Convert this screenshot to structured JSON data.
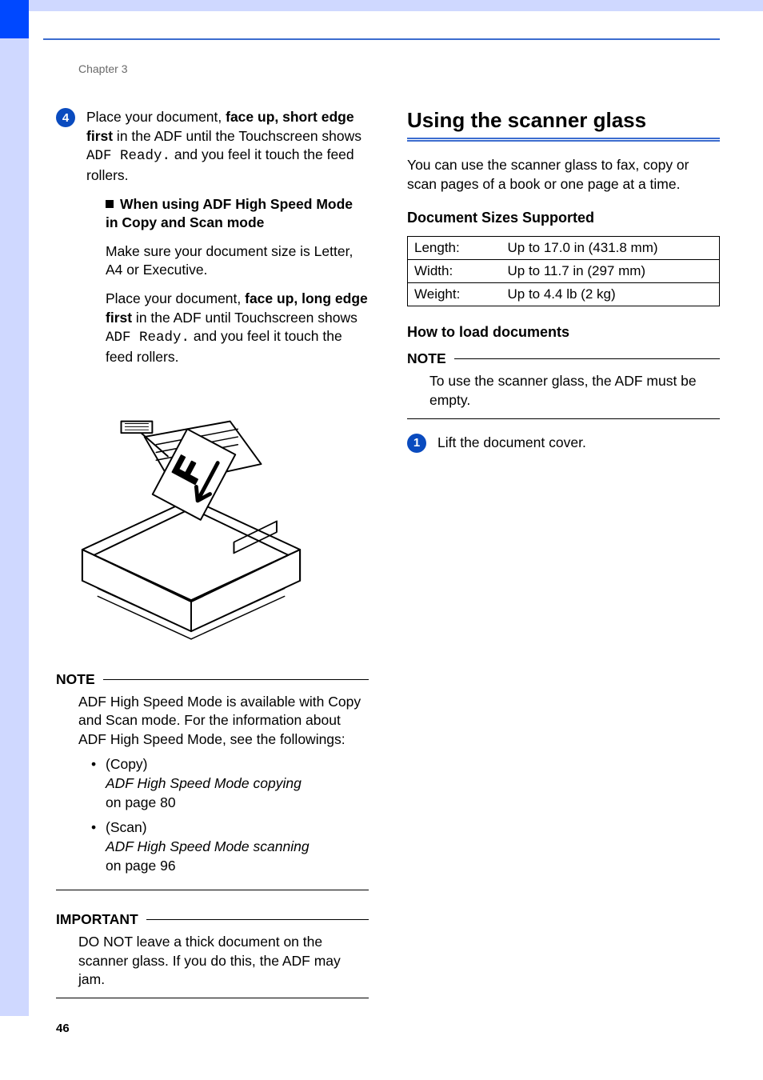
{
  "chapter": "Chapter 3",
  "page_number": "46",
  "left": {
    "step4": {
      "bullet": "4",
      "line1_a": "Place your document, ",
      "line1_b": "face up, short edge first",
      "line1_c": " in the ADF until the Touchscreen shows ",
      "line1_code": "ADF Ready.",
      "line1_d": " and you feel it touch the feed rollers.",
      "sub_heading": "When using ADF High Speed Mode in Copy and Scan mode",
      "sub_p1": "Make sure your document size is Letter, A4 or Executive.",
      "sub_p2_a": "Place your document, ",
      "sub_p2_b": "face up, long edge first",
      "sub_p2_c": " in the ADF until Touchscreen shows ",
      "sub_p2_code": "ADF Ready.",
      "sub_p2_d": " and you feel it touch the feed rollers."
    },
    "note": {
      "title": "NOTE",
      "body": "ADF High Speed Mode is available with Copy and Scan mode. For the information about ADF High Speed Mode, see the followings:",
      "items": [
        {
          "label": "(Copy)",
          "ital": "ADF High Speed Mode copying",
          "ref": "on page 80"
        },
        {
          "label": "(Scan)",
          "ital": "ADF High Speed Mode scanning",
          "ref": "on page 96"
        }
      ]
    },
    "important": {
      "title": "IMPORTANT",
      "body": "DO NOT leave a thick document on the scanner glass. If you do this, the ADF may jam."
    }
  },
  "right": {
    "heading": "Using the scanner glass",
    "intro": "You can use the scanner glass to fax, copy or scan pages of a book or one page at a time.",
    "specs_heading": "Document Sizes Supported",
    "specs": [
      {
        "k": "Length:",
        "v": "Up to 17.0 in (431.8 mm)"
      },
      {
        "k": "Width:",
        "v": "Up to 11.7 in (297 mm)"
      },
      {
        "k": "Weight:",
        "v": "Up to 4.4 lb (2 kg)"
      }
    ],
    "howto_heading": "How to load documents",
    "note": {
      "title": "NOTE",
      "body": "To use the scanner glass, the ADF must be empty."
    },
    "step1": {
      "bullet": "1",
      "text": "Lift the document cover."
    }
  }
}
